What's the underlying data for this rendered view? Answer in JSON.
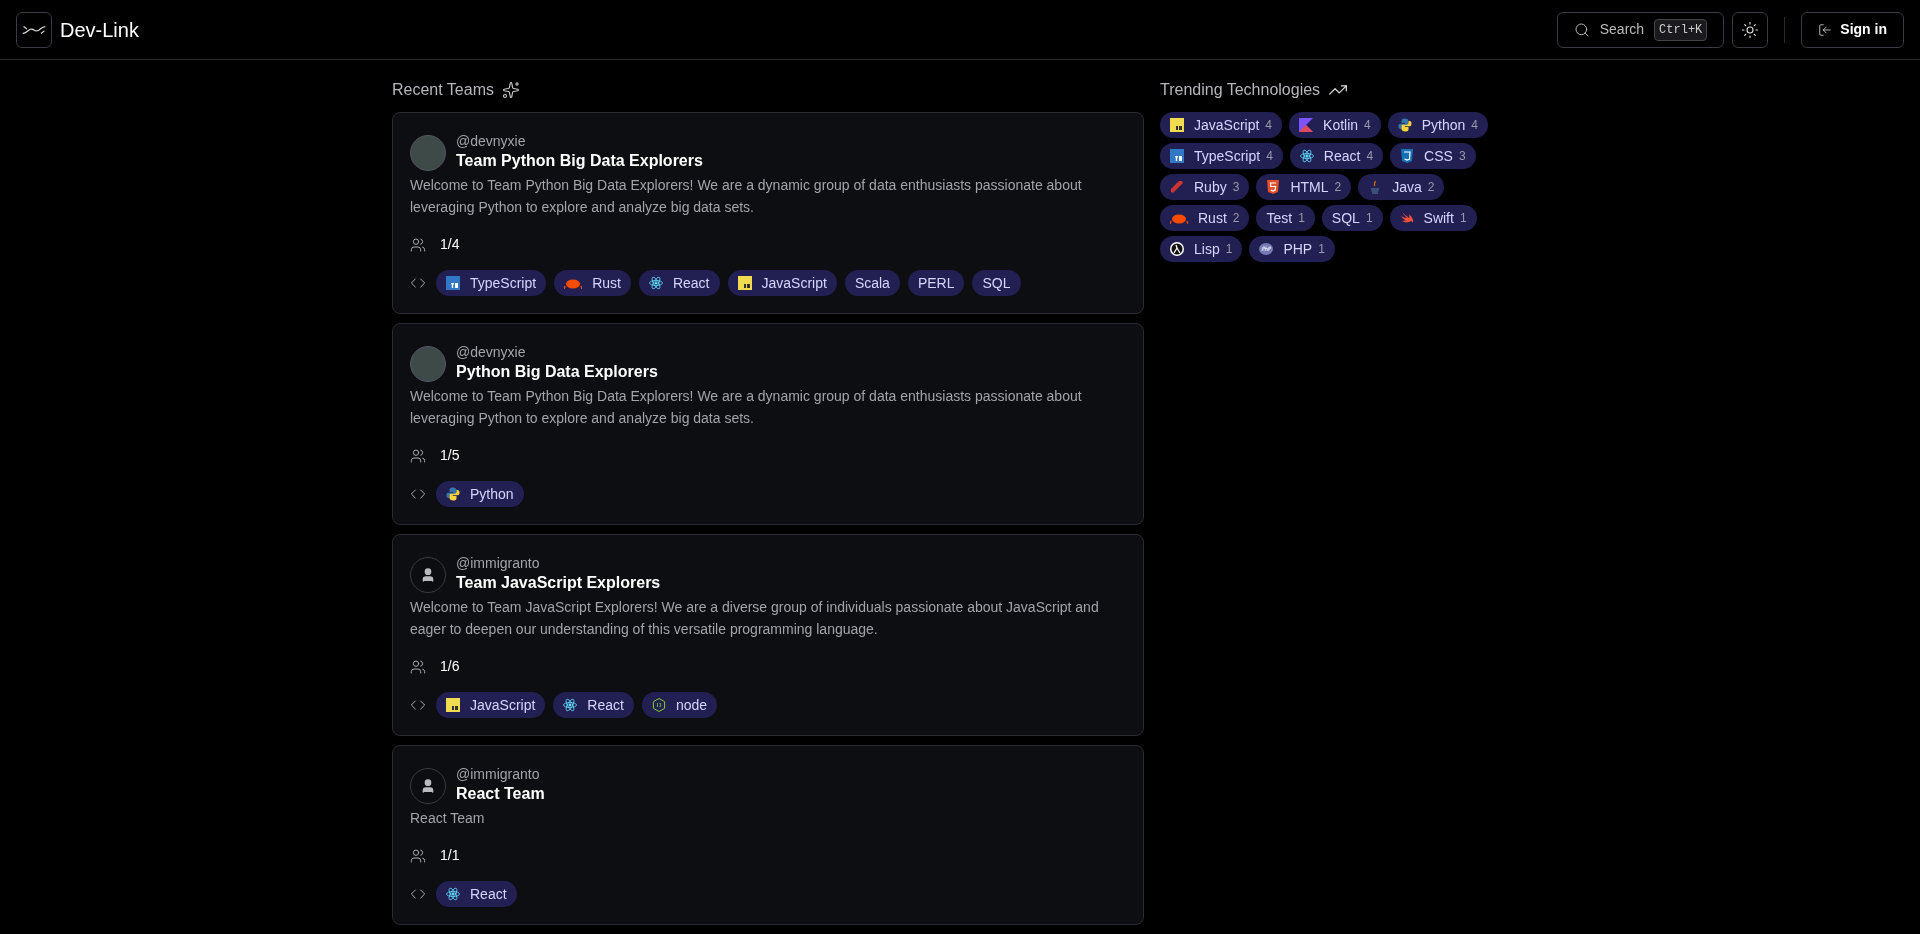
{
  "header": {
    "brand": "Dev-Link",
    "search": {
      "label": "Search",
      "shortcut": "Ctrl+K"
    },
    "sign_in": "Sign in"
  },
  "recent_teams": {
    "title": "Recent Teams",
    "teams": [
      {
        "owner": "@devnyxie",
        "avatar": {
          "kind": "photo"
        },
        "name": "Team Python Big Data Explorers",
        "description": "Welcome to Team Python Big Data Explorers! We are a dynamic group of data enthusiasts passionate about leveraging Python to explore and analyze big data sets.",
        "members": "1/4",
        "technologies": [
          {
            "label": "TypeScript",
            "kind": "ts"
          },
          {
            "label": "Rust",
            "kind": "rust"
          },
          {
            "label": "React",
            "kind": "react"
          },
          {
            "label": "JavaScript",
            "kind": "js"
          },
          {
            "label": "Scala",
            "kind": "plain"
          },
          {
            "label": "PERL",
            "kind": "plain"
          },
          {
            "label": "SQL",
            "kind": "plain"
          }
        ]
      },
      {
        "owner": "@devnyxie",
        "avatar": {
          "kind": "photo"
        },
        "name": "Python Big Data Explorers",
        "description": "Welcome to Team Python Big Data Explorers! We are a dynamic group of data enthusiasts passionate about leveraging Python to explore and analyze big data sets.",
        "members": "1/5",
        "technologies": [
          {
            "label": "Python",
            "kind": "python"
          }
        ]
      },
      {
        "owner": "@immigranto",
        "avatar": {
          "kind": "default"
        },
        "name": "Team JavaScript Explorers",
        "description": "Welcome to Team JavaScript Explorers! We are a diverse group of individuals passionate about JavaScript and eager to deepen our understanding of this versatile programming language.",
        "members": "1/6",
        "technologies": [
          {
            "label": "JavaScript",
            "kind": "js"
          },
          {
            "label": "React",
            "kind": "react"
          },
          {
            "label": "node",
            "kind": "node"
          }
        ]
      },
      {
        "owner": "@immigranto",
        "avatar": {
          "kind": "default"
        },
        "name": "React Team",
        "description": "React Team",
        "members": "1/1",
        "technologies": [
          {
            "label": "React",
            "kind": "react"
          }
        ]
      }
    ]
  },
  "trending": {
    "title": "Trending Technologies",
    "technologies": [
      {
        "label": "JavaScript",
        "count": "4",
        "kind": "js"
      },
      {
        "label": "Kotlin",
        "count": "4",
        "kind": "kotlin"
      },
      {
        "label": "Python",
        "count": "4",
        "kind": "python"
      },
      {
        "label": "TypeScript",
        "count": "4",
        "kind": "ts"
      },
      {
        "label": "React",
        "count": "4",
        "kind": "react"
      },
      {
        "label": "CSS",
        "count": "3",
        "kind": "css"
      },
      {
        "label": "Ruby",
        "count": "3",
        "kind": "ruby"
      },
      {
        "label": "HTML",
        "count": "2",
        "kind": "html"
      },
      {
        "label": "Java",
        "count": "2",
        "kind": "java"
      },
      {
        "label": "Rust",
        "count": "2",
        "kind": "rust"
      },
      {
        "label": "Test",
        "count": "1",
        "kind": "plain"
      },
      {
        "label": "SQL",
        "count": "1",
        "kind": "plain"
      },
      {
        "label": "Swift",
        "count": "1",
        "kind": "swift"
      },
      {
        "label": "Lisp",
        "count": "1",
        "kind": "lisp"
      },
      {
        "label": "PHP",
        "count": "1",
        "kind": "php"
      }
    ]
  }
}
